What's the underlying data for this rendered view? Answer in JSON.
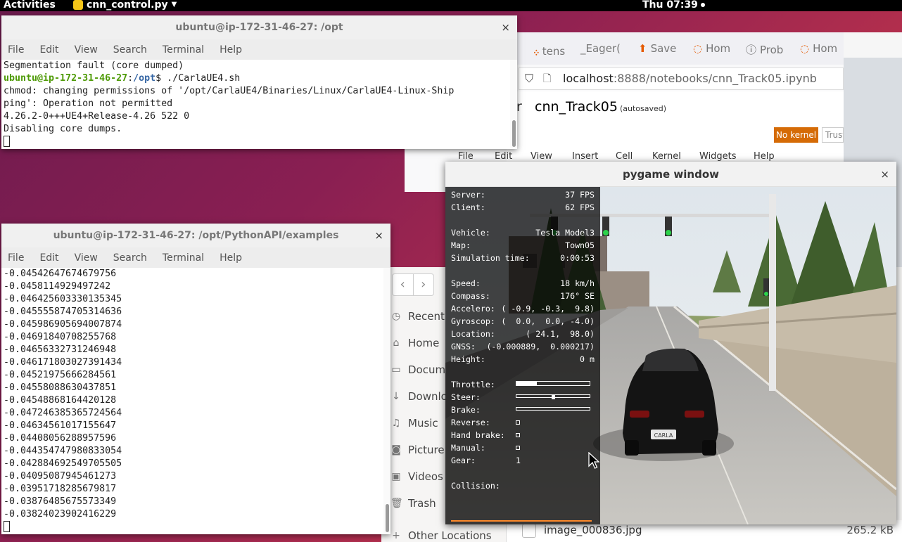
{
  "topbar": {
    "activities": "Activities",
    "app_name": "cnn_control.py",
    "clock": "Thu 07:39"
  },
  "term1": {
    "title": "ubuntu@ip-172-31-46-27: /opt",
    "close": "×",
    "menu": [
      "File",
      "Edit",
      "View",
      "Search",
      "Terminal",
      "Help"
    ],
    "line1": "Segmentation fault (core dumped)",
    "prompt_user": "ubuntu@ip-172-31-46-27",
    "prompt_path": "/opt",
    "prompt_cmd": "$ ./CarlaUE4.sh",
    "line3": "chmod: changing permissions of '/opt/CarlaUE4/Binaries/Linux/CarlaUE4-Linux-Ship",
    "line4": "ping': Operation not permitted",
    "line5": "4.26.2-0+++UE4+Release-4.26 522 0",
    "line6": "Disabling core dumps."
  },
  "term2": {
    "title": "ubuntu@ip-172-31-46-27: /opt/PythonAPI/examples",
    "close": "×",
    "menu": [
      "File",
      "Edit",
      "View",
      "Search",
      "Terminal",
      "Help"
    ],
    "lines": [
      "-0.04542647674679756",
      "-0.0458114929497242",
      "-0.046425603330135345",
      "-0.045555874705314636",
      "-0.045986905694007874",
      "-0.04691840708255768",
      "-0.04656332731246948",
      "-0.046171803027391434",
      "-0.04521975666284561",
      "-0.04558088630437851",
      "-0.04548868164420128",
      "-0.047246385365724564",
      "-0.04634561017155647",
      "-0.04408056288957596",
      "-0.044354747980833054",
      "-0.042884692549705505",
      "-0.04095087945461273",
      "-0.03951718285679817",
      "-0.03876485675573349",
      "-0.03824023902416229"
    ]
  },
  "browser": {
    "tabs": [
      "tens",
      "_Eager(",
      "Save",
      "Hom",
      "Prob",
      "Hom"
    ],
    "url_host": "localhost",
    "url_rest": ":8888/notebooks/cnn_Track05.ipynb",
    "notebook_prefix": "r",
    "notebook_name": "cnn_Track05",
    "autosaved": "(autosaved)",
    "no_kernel": "No kernel",
    "trust": "Trust",
    "menu": [
      "File",
      "Edit",
      "View",
      "Insert",
      "Cell",
      "Kernel",
      "Widgets",
      "Help"
    ]
  },
  "files": {
    "sidebar": [
      "Recent",
      "Home",
      "Docume",
      "Downlo",
      "Music",
      "Picture",
      "Videos",
      "Trash",
      "Other Locations"
    ],
    "file_name": "image_000836.jpg",
    "file_size": "265.2 kB"
  },
  "pygame": {
    "title": "pygame window",
    "close": "×",
    "hud": {
      "server_label": "Server:",
      "server": "37 FPS",
      "client_label": "Client:",
      "client": "62 FPS",
      "vehicle_label": "Vehicle:",
      "vehicle": "Tesla Model3",
      "map_label": "Map:",
      "map": "Town05",
      "simtime_label": "Simulation time:",
      "simtime": "0:00:53",
      "speed_label": "Speed:",
      "speed": "18 km/h",
      "compass_label": "Compass:",
      "compass": "176° SE",
      "accel_label": "Accelero:",
      "accel": "( -0.9, -0.3,  9.8)",
      "gyro_label": "Gyroscop:",
      "gyro": "(  0.0,  0.0, -4.0)",
      "location_label": "Location:",
      "location": "( 24.1,  98.0)",
      "gnss_label": "GNSS:",
      "gnss": "(-0.000889,  0.000217)",
      "height_label": "Height:",
      "height": "0 m",
      "throttle_label": "Throttle:",
      "throttle_fraction": 0.28,
      "steer_label": "Steer:",
      "steer_value": 0.0,
      "brake_label": "Brake:",
      "brake_fraction": 0.0,
      "reverse_label": "Reverse:",
      "handbrake_label": "Hand brake:",
      "manual_label": "Manual:",
      "gear_label": "Gear:",
      "gear": "1",
      "collision_label": "Collision:"
    },
    "plate": "CARLA"
  },
  "colors": {
    "prompt_green": "#4e9a06",
    "prompt_blue": "#3465a4",
    "no_kernel_bg": "#d56b06",
    "collision_bar": "#ff8a2a",
    "desktop_start": "#6d1b4e",
    "desktop_end": "#e0543c"
  }
}
